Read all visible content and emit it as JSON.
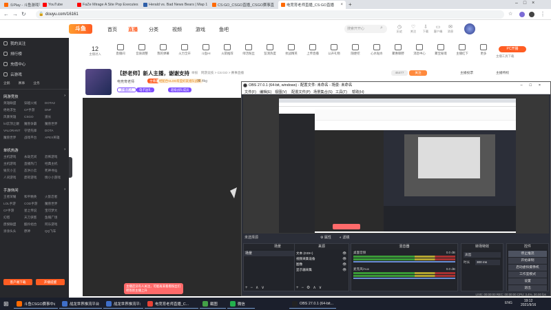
{
  "colors": {
    "accent": "#ff5d23",
    "purple": "#7c4dff",
    "obs_bg": "#2b2e38",
    "sidebar": "#27282c"
  },
  "browser": {
    "tabs": [
      {
        "label": "斗Play - 斗鱼游戏平台",
        "color": "#ff6a00"
      },
      {
        "label": "YouTube",
        "color": "#ff0000"
      },
      {
        "label": "FaZe Mirage A Site Pop Executes",
        "color": "#ff0000"
      },
      {
        "label": "Herald vs. Bad News Bears | Map 1",
        "color": "#2f5fa8"
      },
      {
        "label": "CS:GO_CSGO直播_CSGO赛事直",
        "color": "#ff6a00"
      },
      {
        "label": "电竞育老师直播_CS:GO直播",
        "color": "#ff6a00"
      }
    ],
    "url": "douyu.com/16161"
  },
  "site": {
    "logo": "斗鱼",
    "nav": [
      "首页",
      "直播",
      "分类",
      "视频",
      "游戏",
      "鱼吧"
    ],
    "search_placeholder": "搜索开开心",
    "header_icons": [
      "历史",
      "关注",
      "下载",
      "客户端",
      "消息"
    ]
  },
  "sidebar": {
    "top": [
      "我的关注",
      "排行榜",
      "充值中心",
      "云游戏",
      "企鹅",
      "赛事",
      "业务"
    ],
    "groups": [
      {
        "title": "网游竞技",
        "items": [
          "英雄联盟",
          "穿越火线",
          "DOTA2",
          "绝地求生",
          "CF手游",
          "DNF",
          "风暴英雄",
          "CSGO",
          "道长",
          "lol云顶之巅",
          "魔兽争霸",
          "魔兽世界",
          "VALORANT",
          "守望先锋",
          "DOTA",
          "魔兽世界",
          "战戏平台",
          "APEX英雄"
        ]
      },
      {
        "title": "单机热游",
        "items": [
          "主机游戏",
          "永劫无间",
          "恐怖游戏",
          "主机游戏",
          "直播热门",
          "经典主机",
          "毁灭小王",
          "态洪小云",
          "死神寻仙",
          "人间游戏",
          "废珎游戏",
          "情小小游戏"
        ]
      },
      {
        "title": "手游休闲",
        "items": [
          "王者荣耀",
          "和平精英",
          "火影忍者",
          "LOL手游",
          "COD手游",
          "魔兽世界",
          "CF手游",
          "星之传说",
          "宝可梦大",
          "幻塔",
          "天刀侠客",
          "鱼帽广场",
          "废揬联盟",
          "酷伶组合",
          "阿乐游戏",
          "涂涂头头",
          "原神",
          "QQ飞车"
        ]
      }
    ],
    "bottom_buttons": [
      "客户端下载",
      "开播提醒"
    ]
  },
  "categories": {
    "count": "12",
    "count_label": "主播进入",
    "items": [
      "直播间",
      "音质调整",
      "我的弹幕",
      "火力全开",
      "斗鱼HI",
      "火箭推荐",
      "绿活粉丝",
      "监测热度",
      "抗战精英",
      "上传直播",
      "公开礼物",
      "随便挖",
      "心水贴水",
      "聚惠聊野",
      "消息中心",
      "聚宝秘境",
      "主播红下",
      "更多"
    ],
    "pc_live": "PC开播",
    "pc_live_sub": "主播工具下载"
  },
  "room": {
    "title": "【舒老师】新人主播，谢谢支持",
    "tag": "举报",
    "category": "网游竞技 > CS:GO > 赛事直播",
    "streamer": "电竞育老师",
    "badge": "主播定制",
    "followers": "72.4kg",
    "badge2": "经配合VLOG有些好友组队战赛",
    "follow_count": "46477",
    "follow_btn": "关注",
    "level": "开播新人",
    "tag1": "电子送礼",
    "tag2": "超级战队成员",
    "right_links": [
      "主播投票",
      "主播特权"
    ],
    "bottom_notice": "主播还没有人关注，可能再来看看粉丝们吧等新主播上升"
  },
  "obs": {
    "title": "OBS 27.0.1 (64-bit, windows) - 配置文件: 未命名 - 场景: 未命名",
    "menu": [
      "文件(F)",
      "编辑(E)",
      "视图(V)",
      "配置文件(P)",
      "场景集合(S)",
      "工具(T)",
      "帮助(H)"
    ],
    "status_bar": "未选择源",
    "props_btn": "属性",
    "filter_btn": "滤镜",
    "panels": {
      "scenes": "场景",
      "sources": "来源",
      "mixer": "混音器",
      "transitions": "转场特效",
      "controls": "控件"
    },
    "scene_items": [
      "场景"
    ],
    "source_items": [
      "文本 (GDI+)",
      "视频采集设备",
      "图像",
      "显示器采集"
    ],
    "mixer_items": [
      {
        "name": "桌面音频",
        "db": "0.0 dB"
      },
      {
        "name": "麦克风/Aux",
        "db": "0.0 dB"
      }
    ],
    "transition": "淡出",
    "duration_label": "时长",
    "duration": "300 ms",
    "controls": [
      "停止推流",
      "开始录制",
      "启动虚拟摄像机",
      "工作室模式",
      "设置",
      "退出"
    ],
    "footer": "LIVE: 00:00:00   REC: 00:00:00   CPU: 3.4%, 30.00 fps"
  },
  "taskbar": {
    "items": [
      {
        "label": "斗鱼CSGO赛事中心",
        "color": "#ff6a00"
      },
      {
        "label": "战龙世界推流平台",
        "color": "#3f6fc9"
      },
      {
        "label": "战龙世界推流平台",
        "color": "#3f6fc9"
      },
      {
        "label": "电竞育老师直播_C...",
        "color": "#e94235"
      },
      {
        "label": "截图",
        "color": "#43a047"
      },
      {
        "label": "微信",
        "color": "#23b14d"
      },
      {
        "label": "OBS 27.0.1 (64-bit...",
        "color": "#222"
      }
    ],
    "search_placeholder": "在这里输入你要搜索的内容",
    "lang": "ENG",
    "time": "19:12",
    "date": "2021/9/16"
  }
}
